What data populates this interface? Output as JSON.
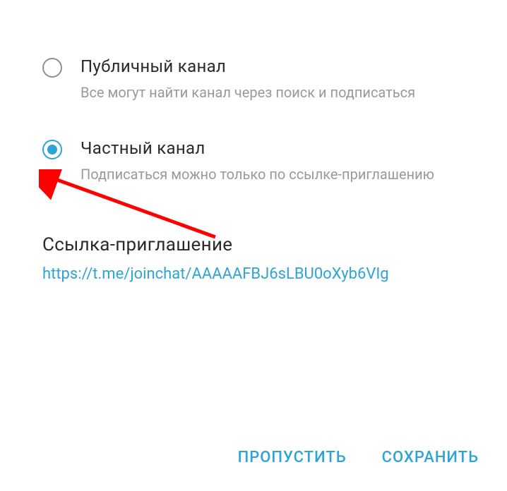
{
  "options": {
    "public": {
      "title": "Публичный канал",
      "description": "Все могут найти канал через поиск и подписаться"
    },
    "private": {
      "title": "Частный канал",
      "description": "Подписаться можно только по ссылке-приглашению"
    }
  },
  "invite": {
    "title": "Ссылка-приглашение",
    "link": "https://t.me/joinchat/AAAAAFBJ6sLBU0oXyb6VIg"
  },
  "footer": {
    "skip_label": "ПРОПУСТИТЬ",
    "save_label": "СОХРАНИТЬ"
  }
}
